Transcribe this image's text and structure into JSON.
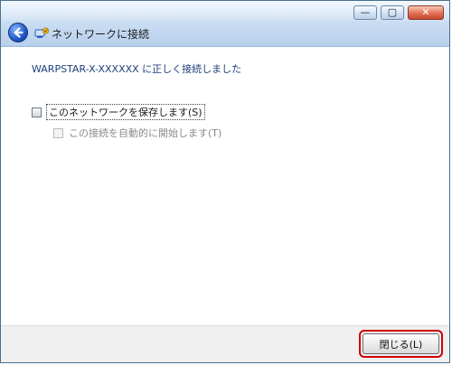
{
  "window": {
    "title": "ネットワークに接続",
    "caption_buttons": {
      "minimize_glyph": "—",
      "maximize_glyph": "▢",
      "close_glyph": "✕"
    }
  },
  "content": {
    "status": "WARPSTAR-X-XXXXXX に正しく接続しました",
    "options": [
      {
        "label": "このネットワークを保存します(S)",
        "checked": false,
        "enabled": true
      },
      {
        "label": "この接続を自動的に開始します(T)",
        "checked": false,
        "enabled": false
      }
    ]
  },
  "footer": {
    "close_button_label": "閉じる(L)"
  },
  "icons": {
    "back": "back-arrow-icon",
    "network": "network-connect-icon",
    "minimize": "minimize-icon",
    "maximize": "maximize-icon",
    "close": "close-icon"
  },
  "colors": {
    "status_text": "#1f3f7a",
    "highlight": "#d00000"
  }
}
